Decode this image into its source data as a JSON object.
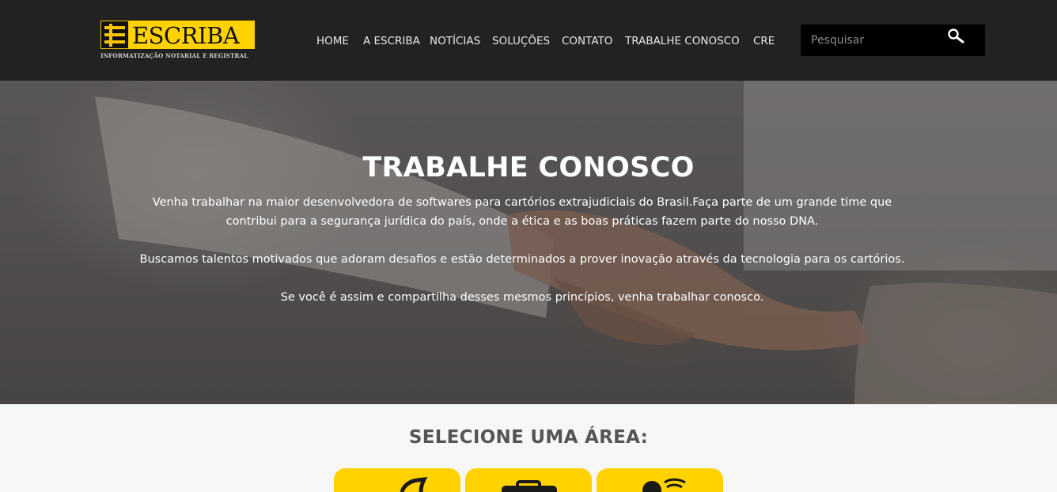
{
  "header": {
    "logo": {
      "name": "ESCRIBA",
      "tagline": "INFORMATIZAÇÃO NOTARIAL E REGISTRAL"
    },
    "nav": [
      {
        "label": "HOME"
      },
      {
        "label": "A ESCRIBA"
      },
      {
        "label": "NOTÍCIAS"
      },
      {
        "label": "SOLUÇÕES"
      },
      {
        "label": "CONTATO"
      },
      {
        "label": "TRABALHE CONOSCO"
      },
      {
        "label": "CRE"
      }
    ],
    "search": {
      "placeholder": "Pesquisar",
      "value": "",
      "icon": "search-icon"
    }
  },
  "hero": {
    "title": "TRABALHE CONOSCO",
    "paragraph1_line1": "Venha trabalhar na maior desenvolvedora de softwares para cartórios extrajudiciais do Brasil.Faça parte de um grande time que",
    "paragraph1_line2": "contribui para a segurança jurídica do país, onde a ética e as boas práticas fazem parte do nosso DNA.",
    "paragraph2": "Buscamos talentos motivados que adoram desafios e estão determinados a prover inovação através da tecnologia para os cartórios.",
    "paragraph3": "Se você é assim e compartilha desses mesmos princípios, venha trabalhar conosco."
  },
  "areas": {
    "title": "SELECIONE UMA ÁREA:",
    "cards": [
      {
        "icon": "leaf-icon"
      },
      {
        "icon": "briefcase-icon"
      },
      {
        "icon": "support-agent-icon"
      }
    ]
  },
  "colors": {
    "header_bg": "#222222",
    "accent": "#ffd200",
    "search_bg": "#000000",
    "page_bg": "#f7f7f7"
  }
}
